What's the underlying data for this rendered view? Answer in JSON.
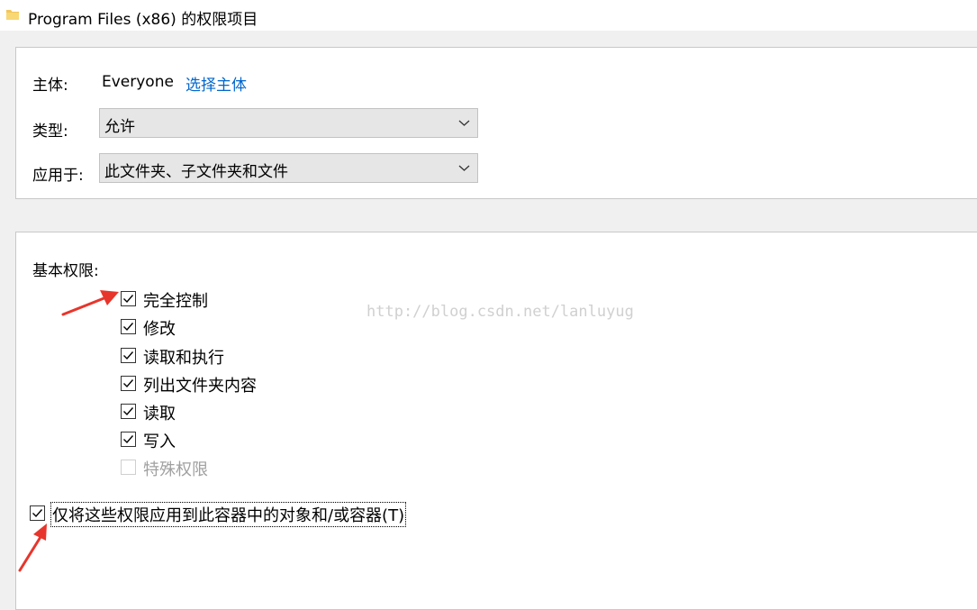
{
  "window": {
    "title": "Program Files (x86) 的权限项目",
    "icon": "folder-icon"
  },
  "principal": {
    "label": "主体:",
    "value": "Everyone",
    "select_link": "选择主体"
  },
  "type": {
    "label": "类型:",
    "selected": "允许"
  },
  "applies_to": {
    "label": "应用于:",
    "selected": "此文件夹、子文件夹和文件"
  },
  "basic_permissions": {
    "heading": "基本权限:",
    "items": [
      {
        "label": "完全控制",
        "checked": true,
        "enabled": true
      },
      {
        "label": "修改",
        "checked": true,
        "enabled": true
      },
      {
        "label": "读取和执行",
        "checked": true,
        "enabled": true
      },
      {
        "label": "列出文件夹内容",
        "checked": true,
        "enabled": true
      },
      {
        "label": "读取",
        "checked": true,
        "enabled": true
      },
      {
        "label": "写入",
        "checked": true,
        "enabled": true
      },
      {
        "label": "特殊权限",
        "checked": false,
        "enabled": false
      }
    ]
  },
  "apply_only": {
    "label": "仅将这些权限应用到此容器中的对象和/或容器(T)",
    "checked": true
  },
  "watermark": "http://blog.csdn.net/lanluyug",
  "colors": {
    "link": "#0066cc",
    "annotation_arrow": "#e8352b",
    "dropdown_bg": "#e6e6e6"
  }
}
